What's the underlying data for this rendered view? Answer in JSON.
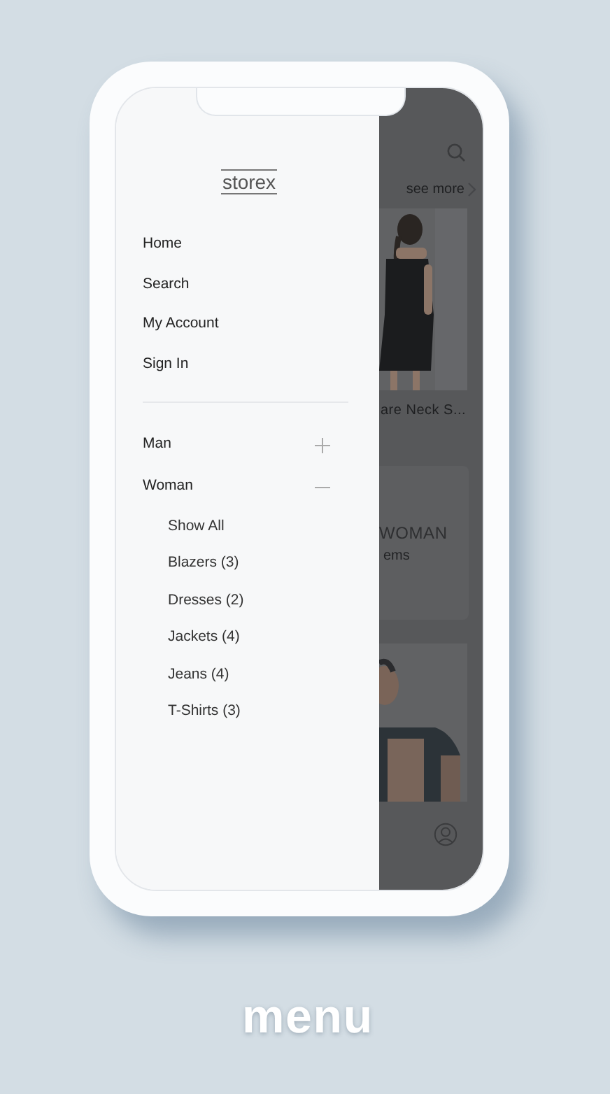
{
  "app_behind": {
    "see_more": "see more",
    "product_name": "are Neck S...",
    "category_title": "WOMAN",
    "category_count": "ems"
  },
  "drawer": {
    "logo": "storex",
    "links": [
      {
        "label": "Home"
      },
      {
        "label": "Search"
      },
      {
        "label": "My Account"
      },
      {
        "label": "Sign In"
      }
    ],
    "categories": [
      {
        "label": "Man",
        "expanded": false
      },
      {
        "label": "Woman",
        "expanded": true,
        "children": [
          {
            "label": "Show All"
          },
          {
            "label": "Blazers (3)"
          },
          {
            "label": "Dresses (2)"
          },
          {
            "label": "Jackets (4)"
          },
          {
            "label": "Jeans (4)"
          },
          {
            "label": "T-Shirts (3)"
          }
        ]
      }
    ]
  },
  "caption": "menu"
}
